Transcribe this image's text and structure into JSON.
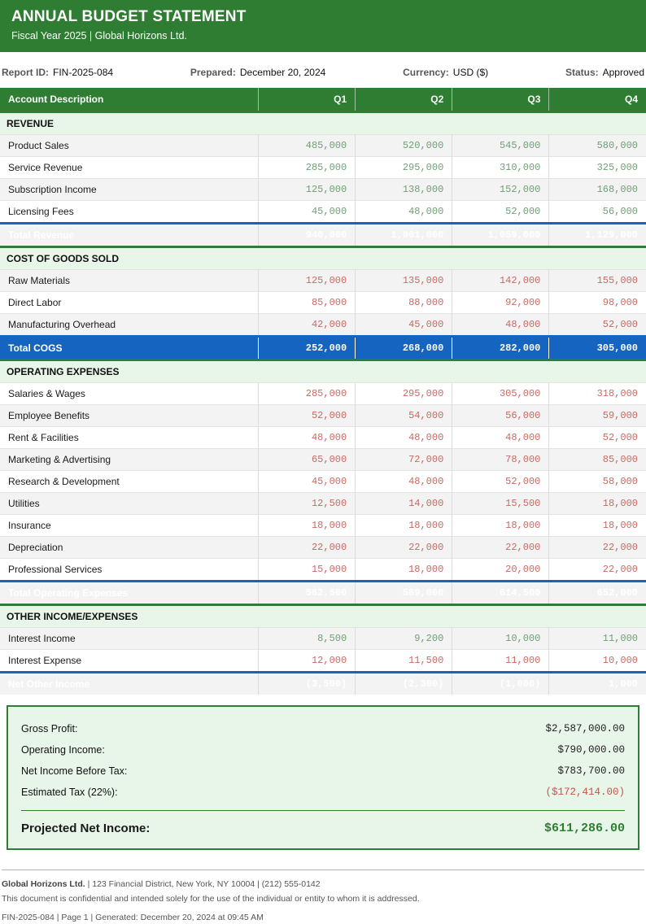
{
  "banner": {
    "title": "ANNUAL BUDGET STATEMENT",
    "subtitle": "Fiscal Year 2025 | Global Horizons Ltd."
  },
  "meta": {
    "report_id_label": "Report ID:",
    "report_id": "FIN-2025-084",
    "prepared_label": "Prepared:",
    "prepared": "December 20, 2024",
    "currency_label": "Currency:",
    "currency": "USD ($)",
    "status_label": "Status:",
    "status": "Approved"
  },
  "table": {
    "columns": [
      "Account Description",
      "Q1",
      "Q2",
      "Q3",
      "Q4"
    ],
    "sections": [
      {
        "title": "REVENUE",
        "rows": [
          {
            "label": "Product Sales",
            "tone": "green",
            "values": [
              "485,000",
              "520,000",
              "545,000",
              "580,000"
            ]
          },
          {
            "label": "Service Revenue",
            "tone": "green",
            "values": [
              "285,000",
              "295,000",
              "310,000",
              "325,000"
            ]
          },
          {
            "label": "Subscription Income",
            "tone": "green",
            "values": [
              "125,000",
              "138,000",
              "152,000",
              "168,000"
            ]
          },
          {
            "label": "Licensing Fees",
            "tone": "green",
            "values": [
              "45,000",
              "48,000",
              "52,000",
              "56,000"
            ]
          }
        ],
        "total": {
          "label": "Total Revenue",
          "variant": "ghost",
          "values": [
            "940,000",
            "1,001,000",
            "1,059,000",
            "1,129,000"
          ]
        }
      },
      {
        "title": "COST OF GOODS SOLD",
        "rows": [
          {
            "label": "Raw Materials",
            "tone": "red",
            "values": [
              "125,000",
              "135,000",
              "142,000",
              "155,000"
            ]
          },
          {
            "label": "Direct Labor",
            "tone": "red",
            "values": [
              "85,000",
              "88,000",
              "92,000",
              "98,000"
            ]
          },
          {
            "label": "Manufacturing Overhead",
            "tone": "red",
            "values": [
              "42,000",
              "45,000",
              "48,000",
              "52,000"
            ]
          }
        ],
        "total": {
          "label": "Total COGS",
          "variant": "blue",
          "values": [
            "252,000",
            "268,000",
            "282,000",
            "305,000"
          ]
        }
      },
      {
        "title": "OPERATING EXPENSES",
        "rows": [
          {
            "label": "Salaries & Wages",
            "tone": "red",
            "values": [
              "285,000",
              "295,000",
              "305,000",
              "318,000"
            ]
          },
          {
            "label": "Employee Benefits",
            "tone": "red",
            "values": [
              "52,000",
              "54,000",
              "56,000",
              "59,000"
            ]
          },
          {
            "label": "Rent & Facilities",
            "tone": "red",
            "values": [
              "48,000",
              "48,000",
              "48,000",
              "52,000"
            ]
          },
          {
            "label": "Marketing & Advertising",
            "tone": "red",
            "values": [
              "65,000",
              "72,000",
              "78,000",
              "85,000"
            ]
          },
          {
            "label": "Research & Development",
            "tone": "red",
            "values": [
              "45,000",
              "48,000",
              "52,000",
              "58,000"
            ]
          },
          {
            "label": "Utilities",
            "tone": "red",
            "values": [
              "12,500",
              "14,000",
              "15,500",
              "18,000"
            ]
          },
          {
            "label": "Insurance",
            "tone": "red",
            "values": [
              "18,000",
              "18,000",
              "18,000",
              "18,000"
            ]
          },
          {
            "label": "Depreciation",
            "tone": "red",
            "values": [
              "22,000",
              "22,000",
              "22,000",
              "22,000"
            ]
          },
          {
            "label": "Professional Services",
            "tone": "red",
            "values": [
              "15,000",
              "18,000",
              "20,000",
              "22,000"
            ]
          }
        ],
        "total": {
          "label": "Total Operating Expenses",
          "variant": "ghost",
          "values": [
            "562,500",
            "589,000",
            "614,500",
            "652,000"
          ]
        }
      },
      {
        "title": "OTHER INCOME/EXPENSES",
        "rows": [
          {
            "label": "Interest Income",
            "tone": "green",
            "values": [
              "8,500",
              "9,200",
              "10,000",
              "11,000"
            ]
          },
          {
            "label": "Interest Expense",
            "tone": "red",
            "values": [
              "12,000",
              "11,500",
              "11,000",
              "10,000"
            ]
          }
        ],
        "total": {
          "label": "Net Other Income",
          "variant": "ghost",
          "values": [
            "(3,500)",
            "(2,300)",
            "(1,000)",
            "1,000"
          ]
        }
      }
    ]
  },
  "summary": {
    "rows": [
      {
        "label": "Gross Profit:",
        "value": "$2,587,000.00"
      },
      {
        "label": "Operating Income:",
        "value": "$790,000.00"
      },
      {
        "label": "Net Income Before Tax:",
        "value": "$783,700.00"
      },
      {
        "label": "Estimated Tax (22%):",
        "value": "($172,414.00)"
      }
    ],
    "net": {
      "label": "Projected Net Income:",
      "value": "$611,286.00"
    }
  },
  "footer": {
    "company": "Global Horizons Ltd.",
    "address_rest": " | 123 Financial District, New York, NY 10004 | (212) 555-0142",
    "confidentiality": "This document is confidential and intended solely for the use of the individual or entity to whom it is addressed.",
    "generated": "FIN-2025-084 | Page 1 | Generated: December 20, 2024 at 09:45 AM"
  },
  "colors": {
    "brand_green": "#2e7d32",
    "light_green": "#e8f5e9",
    "accent_blue": "#1565c0",
    "income_green": "#6f9f74",
    "expense_red": "#c96a63"
  }
}
